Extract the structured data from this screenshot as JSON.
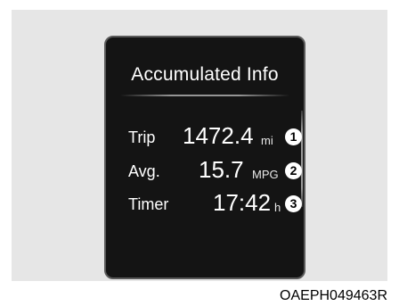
{
  "display": {
    "title": "Accumulated Info",
    "rows": [
      {
        "label": "Trip",
        "value": "1472.4",
        "unit": "mi",
        "marker": "1"
      },
      {
        "label": "Avg.",
        "value": "15.7",
        "unit": "MPG",
        "marker": "2"
      },
      {
        "label": "Timer",
        "value": "17:42",
        "unit": "h",
        "marker": "3"
      }
    ]
  },
  "caption": "OAEPH049463R",
  "colors": {
    "screen": "#141414",
    "text": "#ffffff",
    "frame": "#e6e6e6"
  }
}
